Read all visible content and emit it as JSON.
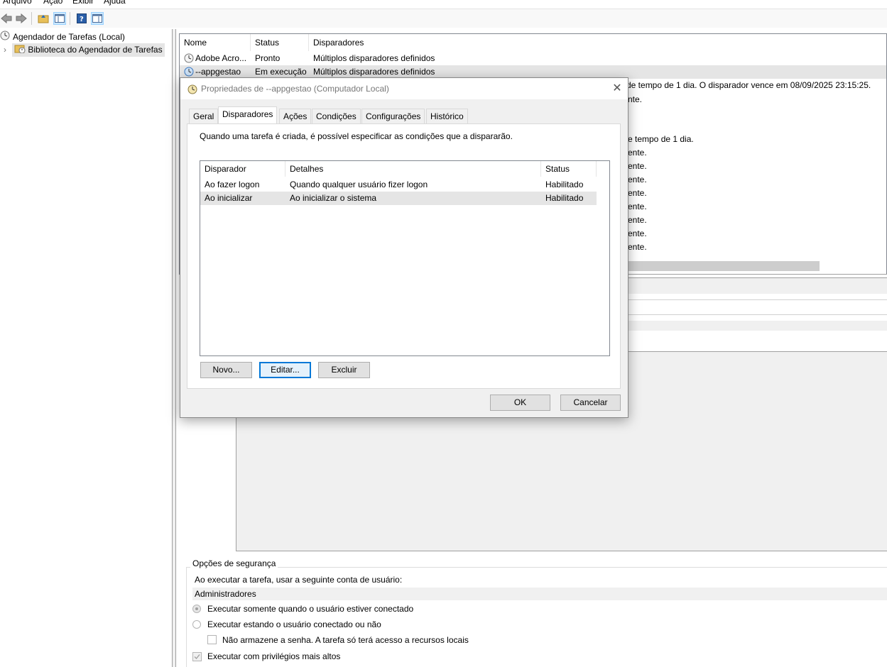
{
  "menu": [
    "Arquivo",
    "Ação",
    "Exibir",
    "Ajuda"
  ],
  "tree": {
    "root": "Agendador de Tarefas (Local)",
    "library": "Biblioteca do Agendador de Tarefas"
  },
  "task_list": {
    "headers": [
      "Nome",
      "Status",
      "Disparadores"
    ],
    "rows": [
      {
        "name": "Adobe Acro...",
        "status": "Pronto",
        "triggers": "Múltiplos disparadores definidos"
      },
      {
        "name": "--appgestao",
        "status": "Em execução",
        "triggers": "Múltiplos disparadores definidos"
      }
    ],
    "background_fragments": [
      "de tempo de 1 dia. O disparador vence em 08/09/2025 23:15:25.",
      "nte.",
      "e tempo de 1 dia.",
      "ente.",
      "ente.",
      "ente.",
      "ente.",
      "ente.",
      "ente.",
      "ente.",
      "ente."
    ]
  },
  "dialog": {
    "title": "Propriedades de --appgestao (Computador Local)",
    "tabs": [
      "Geral",
      "Disparadores",
      "Ações",
      "Condições",
      "Configurações",
      "Histórico"
    ],
    "active_tab": "Disparadores",
    "description": "Quando uma tarefa é criada, é possível especificar as condições que a dispararão.",
    "trigger_headers": [
      "Disparador",
      "Detalhes",
      "Status"
    ],
    "triggers": [
      {
        "trigger": "Ao fazer logon",
        "details": "Quando qualquer usuário fizer logon",
        "status": "Habilitado"
      },
      {
        "trigger": "Ao inicializar",
        "details": "Ao inicializar o sistema",
        "status": "Habilitado"
      }
    ],
    "buttons": {
      "new": "Novo...",
      "edit": "Editar...",
      "delete": "Excluir",
      "ok": "OK",
      "cancel": "Cancelar"
    }
  },
  "security": {
    "section_title": "Opções de segurança",
    "account_label": "Ao executar a tarefa, usar a seguinte conta de usuário:",
    "account_value": "Administradores",
    "radio_logged_on": "Executar somente quando o usuário estiver conectado",
    "radio_any": "Executar estando o usuário conectado ou não",
    "no_store_password": "Não armazene a senha. A tarefa só terá acesso a recursos locais",
    "highest_privileges": "Executar com privilégios mais altos"
  }
}
